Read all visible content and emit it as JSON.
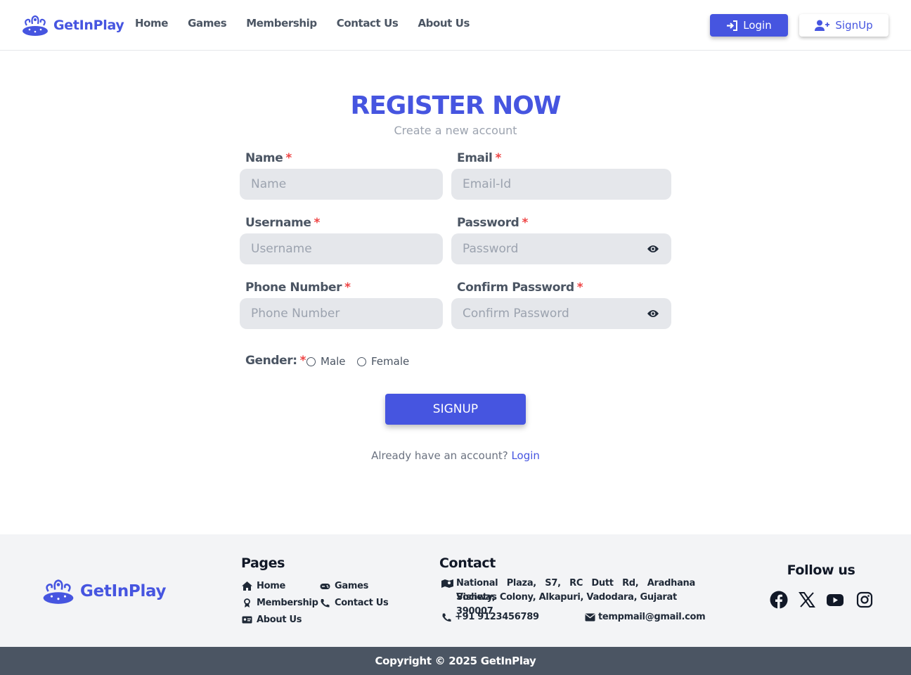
{
  "nav": {
    "brand": "GetInPlay",
    "links": [
      "Home",
      "Games",
      "Membership",
      "Contact Us",
      "About Us"
    ],
    "login_label": "Login",
    "signup_label": "SignUp"
  },
  "register": {
    "title": "REGISTER NOW",
    "subtitle": "Create a new account",
    "required_mark": "*",
    "fields": {
      "name": {
        "label": "Name",
        "placeholder": "Name",
        "value": ""
      },
      "email": {
        "label": "Email",
        "placeholder": "Email-Id",
        "value": ""
      },
      "username": {
        "label": "Username",
        "placeholder": "Username",
        "value": ""
      },
      "password": {
        "label": "Password",
        "placeholder": "Password",
        "value": ""
      },
      "phone": {
        "label": "Phone Number",
        "placeholder": "Phone Number",
        "value": ""
      },
      "confirm": {
        "label": "Confirm Password",
        "placeholder": "Confirm Password",
        "value": ""
      }
    },
    "gender_label": "Gender:",
    "gender_options": [
      "Male",
      "Female"
    ],
    "submit_label": "SIGNUP",
    "already_text": "Already have an account?",
    "login_link": "Login"
  },
  "footer": {
    "brand": "GetInPlay",
    "pages_heading": "Pages",
    "pages": {
      "home": "Home",
      "games": "Games",
      "membership": "Membership",
      "contact": "Contact Us",
      "about": "About Us"
    },
    "contact_heading": "Contact",
    "address_line1": "National Plaza, S7, RC Dutt Rd, Aradhana Society,",
    "address_line2": "Vishwas Colony, Alkapuri, Vadodara, Gujarat 390007",
    "phone": "+91 9123456789",
    "email": "tempmail@gmail.com",
    "follow_heading": "Follow us",
    "socials": [
      "facebook-icon",
      "x-icon",
      "youtube-icon",
      "instagram-icon"
    ],
    "copyright": "Copyright © 2025 GetInPlay"
  },
  "colors": {
    "accent": "#4655e0",
    "required": "#ef4444",
    "input_bg": "#e5e7eb",
    "footer_bg": "#f3f4f6",
    "copyright_bg": "#4b5563"
  }
}
